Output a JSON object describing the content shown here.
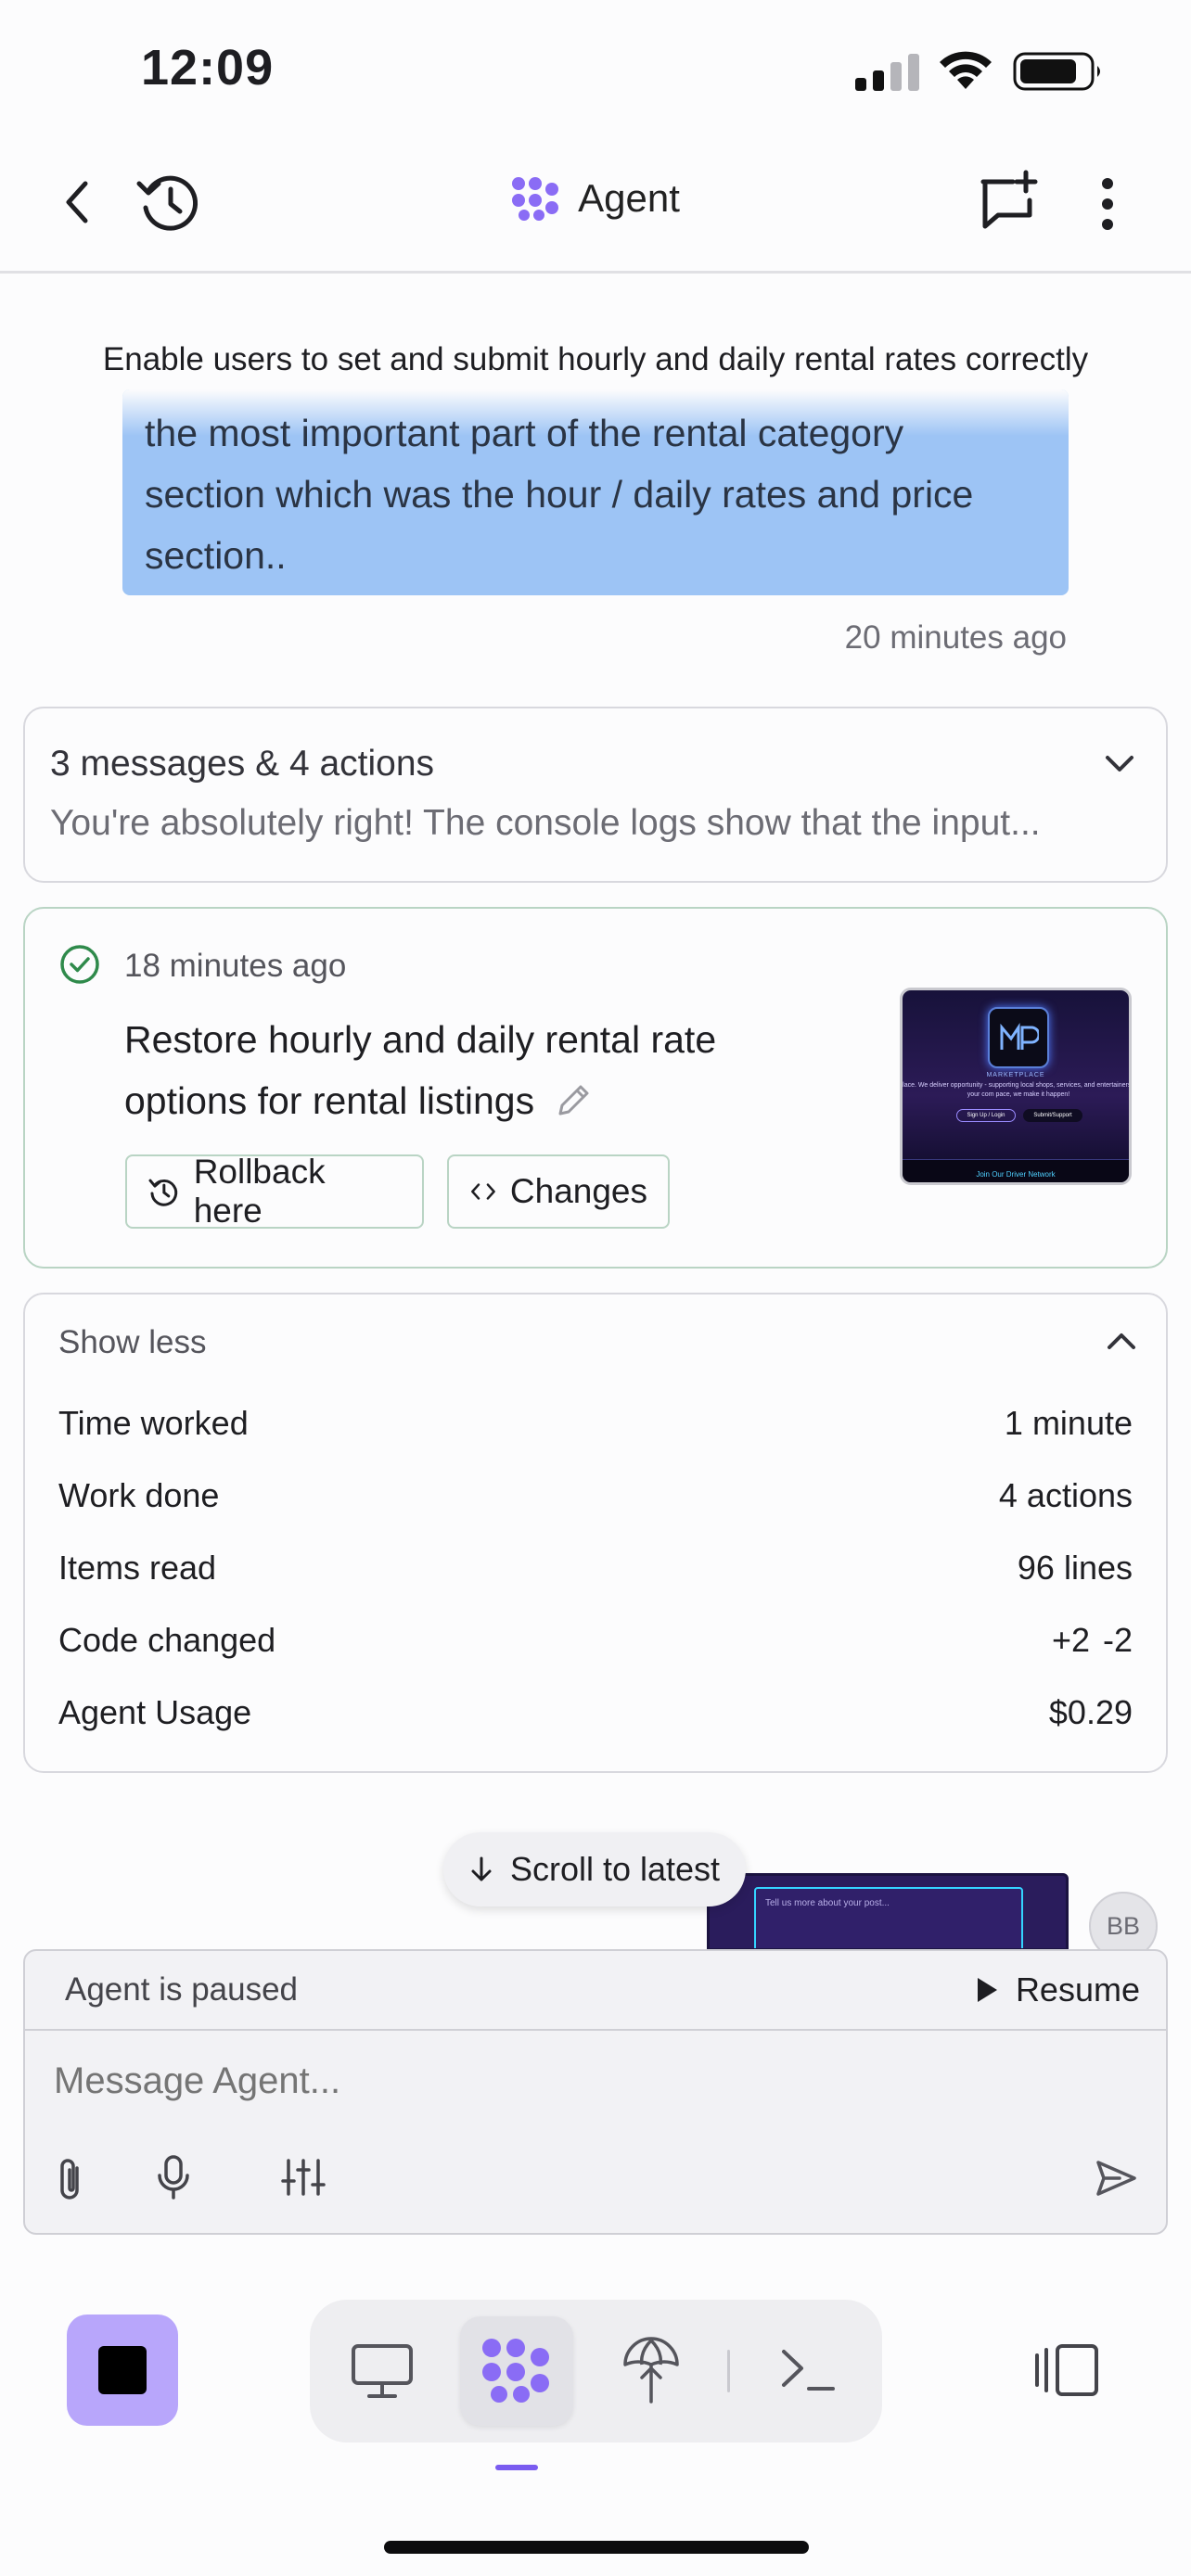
{
  "status_bar": {
    "time": "12:09"
  },
  "header": {
    "title": "Agent"
  },
  "chat": {
    "task_title": "Enable users to set and submit hourly and daily rental rates correctly",
    "user_message_lines": [
      "the most important part of the rental category",
      "section which was the hour / daily rates and price",
      "section.."
    ],
    "user_message_time": "20 minutes ago",
    "summary": {
      "title": "3 messages & 4 actions",
      "preview": "You're absolutely right! The console logs show that the input..."
    },
    "checkpoint": {
      "time": "18 minutes ago",
      "title_line1": "Restore hourly and daily rental rate",
      "title_line2": "options for rental listings",
      "rollback_label": "Rollback here",
      "changes_label": "Changes",
      "thumbnail": {
        "heading": "MARKETPLACE",
        "tagline": "place. We deliver opportunity - supporting local shops, services, and entertainers in your com pace, we make it happen!",
        "button1": "Sign Up / Login",
        "button2": "Submit/Support",
        "footer": "Join Our Driver Network"
      }
    },
    "stats": {
      "toggle_label": "Show less",
      "rows": [
        {
          "label": "Time worked",
          "value": "1 minute"
        },
        {
          "label": "Work done",
          "value": "4 actions"
        },
        {
          "label": "Items read",
          "value": "96 lines"
        },
        {
          "label": "Code changed",
          "value_plus": "+2",
          "value_minus": "-2"
        },
        {
          "label": "Agent Usage",
          "value": "$0.29"
        }
      ]
    },
    "scroll_to_latest": "Scroll to latest",
    "preview_image": {
      "placeholder": "Tell us more about your post..."
    },
    "avatar_initials": "BB"
  },
  "composer": {
    "paused_text": "Agent is paused",
    "resume_label": "Resume",
    "placeholder": "Message Agent..."
  },
  "colors": {
    "accent": "#7a5cf0",
    "user_bubble": "#9dc4f5",
    "checkpoint_border": "#b9d4c4",
    "success": "#2f8a4b"
  }
}
